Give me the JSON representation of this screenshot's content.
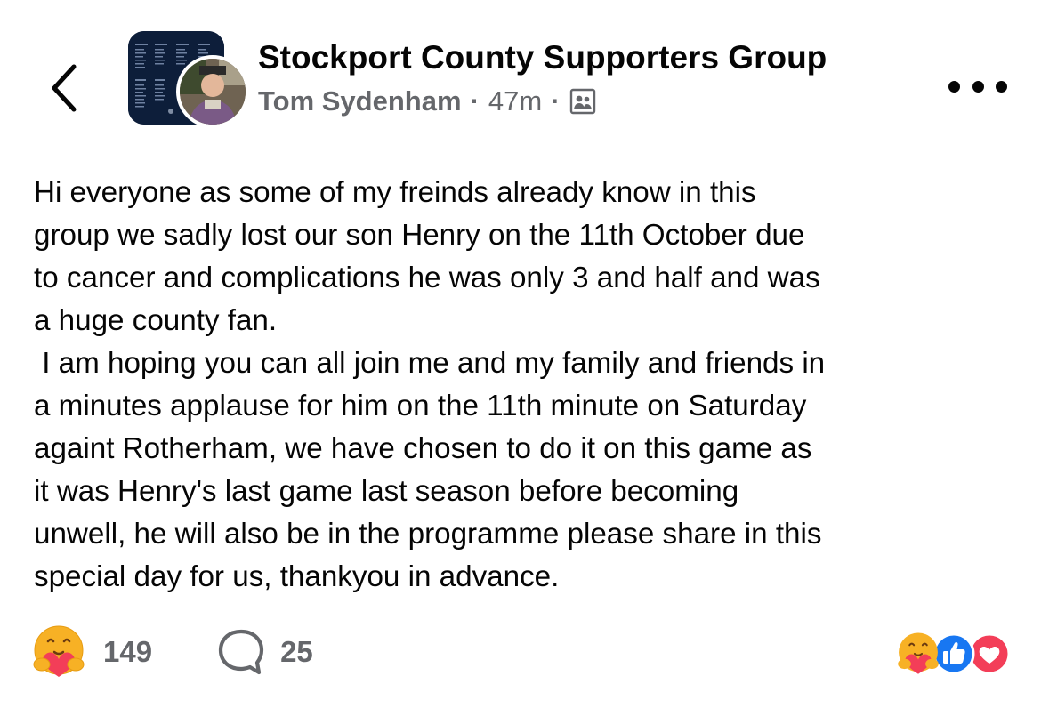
{
  "header": {
    "group_name": "Stockport County Supporters Group",
    "author": "Tom Sydenham",
    "separator": "·",
    "time": "47m",
    "icons": {
      "back": "chevron-left-icon",
      "privacy": "group-members-icon",
      "more": "more-options-icon"
    }
  },
  "post": {
    "lines": [
      "Hi everyone as some of my freinds already know in this",
      "group we sadly lost our son Henry on the 11th October due",
      "to cancer and complications he was only 3 and half and was",
      "a huge county fan.",
      " I am hoping you can all join me and my family and friends in",
      "a minutes applause for him on the 11th minute on Saturday",
      "againt Rotherham, we have chosen to do it on this game as",
      "it was Henry's last game last season before becoming",
      "unwell, he will also be in the programme please share in this",
      "special day for us, thankyou in advance."
    ]
  },
  "footer": {
    "reactions_count": "149",
    "comments_count": "25",
    "reaction_types": [
      "care",
      "like",
      "love"
    ]
  },
  "colors": {
    "text": "#050505",
    "secondary": "#65676b",
    "like": "#1877f2",
    "love": "#f33e58",
    "care": "#f7b125"
  }
}
